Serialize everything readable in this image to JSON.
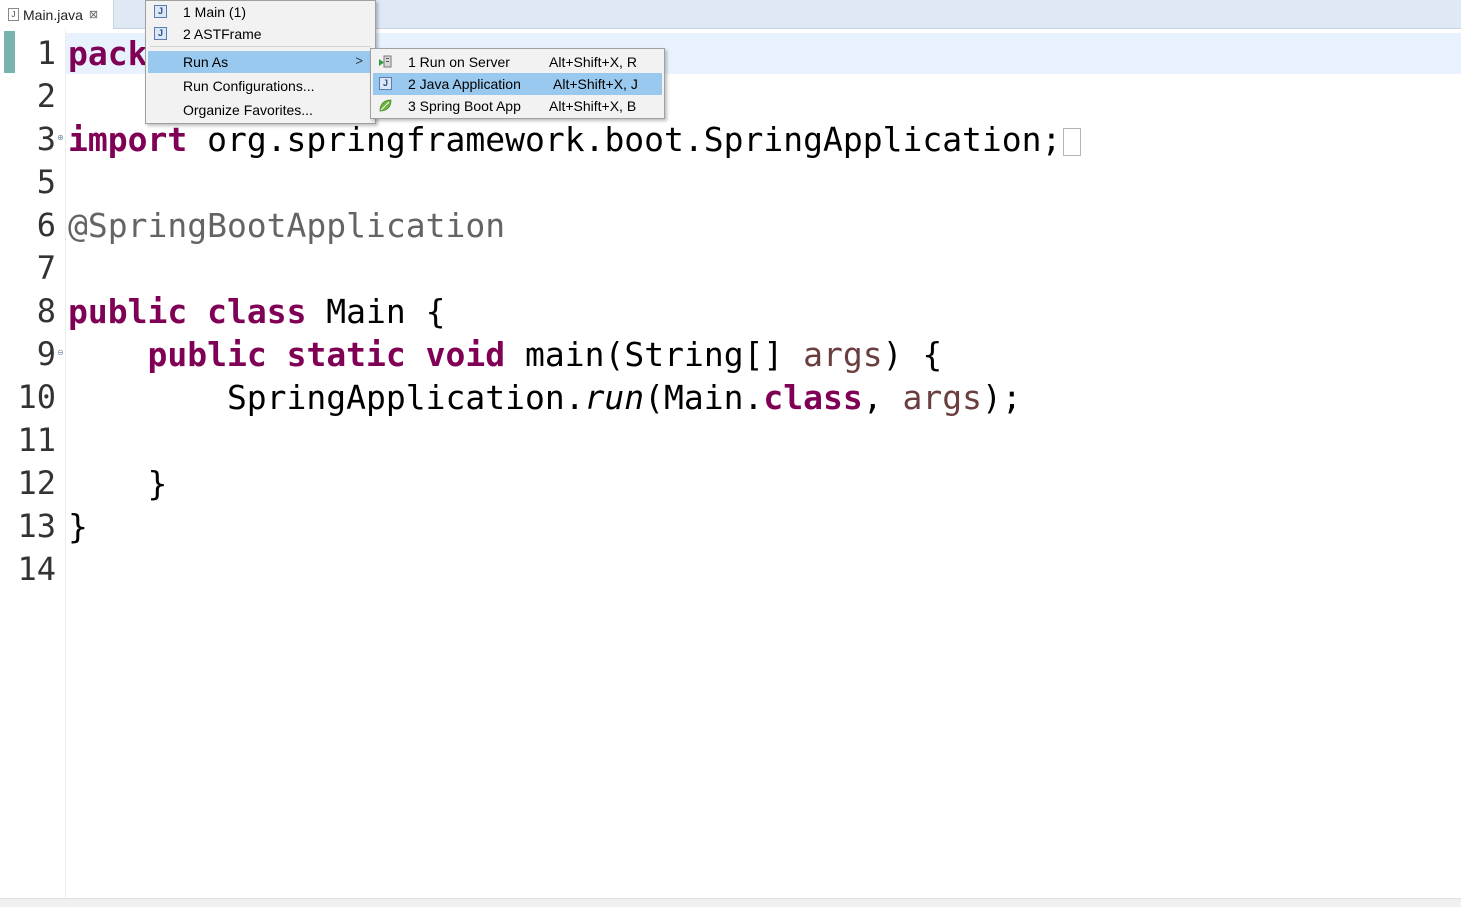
{
  "editor_tab": {
    "filename": "Main.java",
    "file_icon": "java-file-icon",
    "close_icon": "close-icon"
  },
  "editor": {
    "line_numbers": [
      "1",
      "2",
      "3",
      "5",
      "6",
      "7",
      "8",
      "9",
      "10",
      "11",
      "12",
      "13",
      "14"
    ],
    "lines": {
      "l1_kw": "pack",
      "l3_kw": "import",
      "l3_rest": " org.springframework.boot.SpringApplication;",
      "l6_annotation": "@SpringBootApplication",
      "l8_kw1": "public",
      "l8_kw2": "class",
      "l8_rest": " Main {",
      "l9_indent": "    ",
      "l9_kw1": "public",
      "l9_kw2": "static",
      "l9_kw3": "void",
      "l9_mid": " main(String[] ",
      "l9_var": "args",
      "l9_end": ") {",
      "l10_start": "        SpringApplication.",
      "l10_method": "run",
      "l10_mid": "(Main.",
      "l10_kw": "class",
      "l10_comma": ", ",
      "l10_var": "args",
      "l10_end": ");",
      "l12": "    }",
      "l13": "}"
    },
    "fold_expand_icon": "fold-expand-icon",
    "fold_collapse_icon": "fold-collapse-icon"
  },
  "favorites_menu": {
    "items": [
      {
        "label": "1 Main (1)",
        "icon": "java-app-icon"
      },
      {
        "label": "2 ASTFrame",
        "icon": "java-app-icon"
      },
      {
        "label": "Run As",
        "selected": true
      },
      {
        "label": "Run Configurations..."
      },
      {
        "label": "Organize Favorites..."
      }
    ],
    "submenu_arrow": ">"
  },
  "run_as_menu": {
    "items": [
      {
        "label": "1 Run on Server",
        "shortcut": "Alt+Shift+X, R",
        "icon": "server-run-icon"
      },
      {
        "label": "2 Java Application",
        "shortcut": "Alt+Shift+X, J",
        "icon": "java-app-icon",
        "selected": true
      },
      {
        "label": "3 Spring Boot App",
        "shortcut": "Alt+Shift+X, B",
        "icon": "spring-leaf-icon"
      }
    ]
  },
  "colors": {
    "keyword": "#7f0055",
    "annotation": "#646464",
    "variable": "#6a3e3e",
    "menu_selection": "#99c9ef",
    "current_line": "#e8f2fe"
  }
}
